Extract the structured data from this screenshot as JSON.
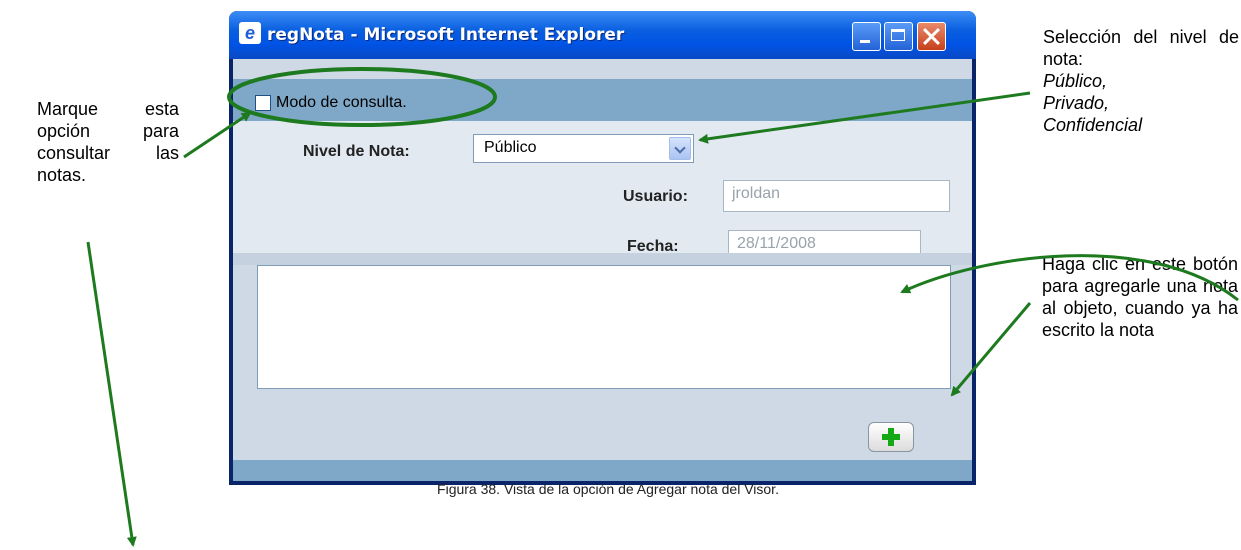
{
  "window": {
    "title": "regNota - Microsoft Internet Explorer"
  },
  "form": {
    "consult_mode_label": "Modo de consulta.",
    "consult_mode_checked": false,
    "nivel_label": "Nivel de Nota:",
    "nivel_value": "Público",
    "usuario_label": "Usuario:",
    "usuario_value": "jroldan",
    "fecha_label": "Fecha:",
    "fecha_value": "28/11/2008",
    "note_text": "",
    "add_button_icon": "plus-icon"
  },
  "annotations": {
    "left": "Marque esta opción para consultar las notas.",
    "right_top_line1": "Selección del nivel de nota:",
    "right_top_options": [
      "Público,",
      "Privado,",
      "Confidencial"
    ],
    "right_bottom": "Haga clic en este botón para agregarle una nota al objeto, cuando ya ha escrito la nota"
  },
  "caption": "Figura 38. Vista de la opción de Agregar nota del Visor.",
  "colors": {
    "arrow": "#1e7a1e",
    "titlebar": "#0a5fe0",
    "plus": "#14a814"
  }
}
